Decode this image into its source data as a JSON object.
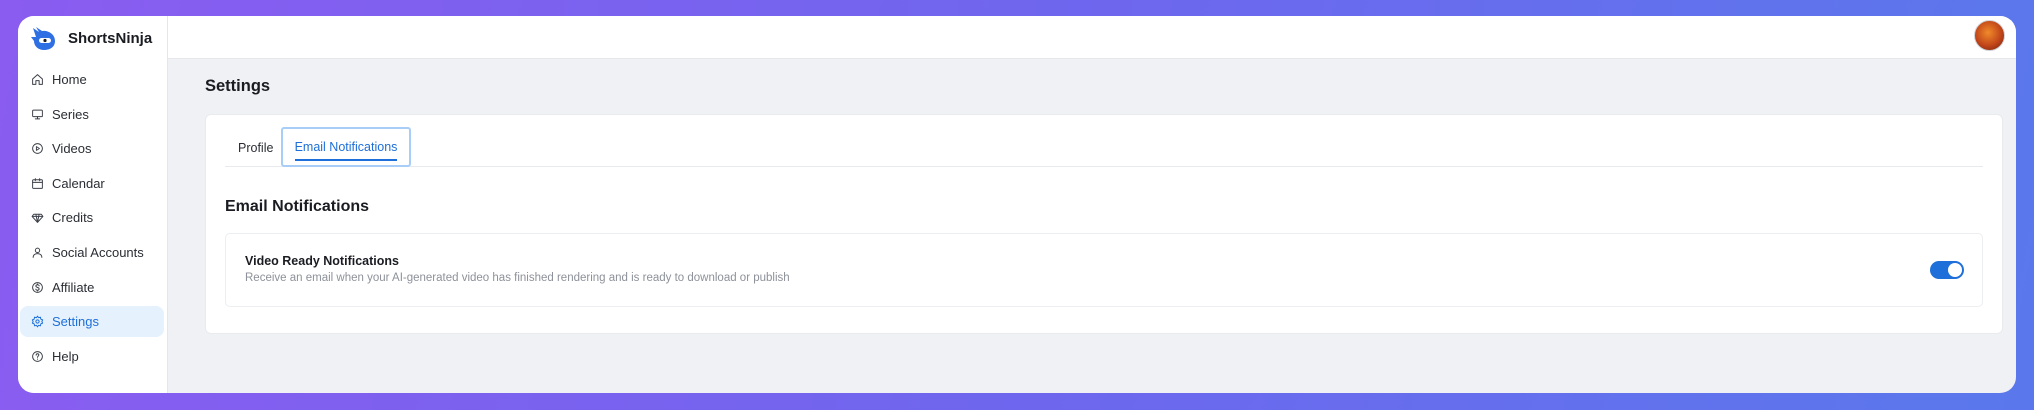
{
  "brand": {
    "name": "ShortsNinja",
    "logo_icon": "ninja-logo-icon",
    "accent": "#1e6fd9"
  },
  "sidebar": {
    "items": [
      {
        "label": "Home",
        "icon": "home-icon"
      },
      {
        "label": "Series",
        "icon": "monitor-icon"
      },
      {
        "label": "Videos",
        "icon": "play-circle-icon"
      },
      {
        "label": "Calendar",
        "icon": "calendar-icon"
      },
      {
        "label": "Credits",
        "icon": "gem-icon"
      },
      {
        "label": "Social Accounts",
        "icon": "user-icon"
      },
      {
        "label": "Affiliate",
        "icon": "dollar-circle-icon"
      },
      {
        "label": "Settings",
        "icon": "gear-icon",
        "active": true
      },
      {
        "label": "Help",
        "icon": "help-circle-icon"
      }
    ]
  },
  "header": {
    "avatar": "user-avatar"
  },
  "page": {
    "title": "Settings"
  },
  "tabs": [
    {
      "label": "Profile"
    },
    {
      "label": "Email Notifications",
      "active": true
    }
  ],
  "section": {
    "title": "Email Notifications",
    "preference": {
      "title": "Video Ready Notifications",
      "description": "Receive an email when your AI-generated video has finished rendering and is ready to download or publish",
      "enabled": true
    }
  }
}
